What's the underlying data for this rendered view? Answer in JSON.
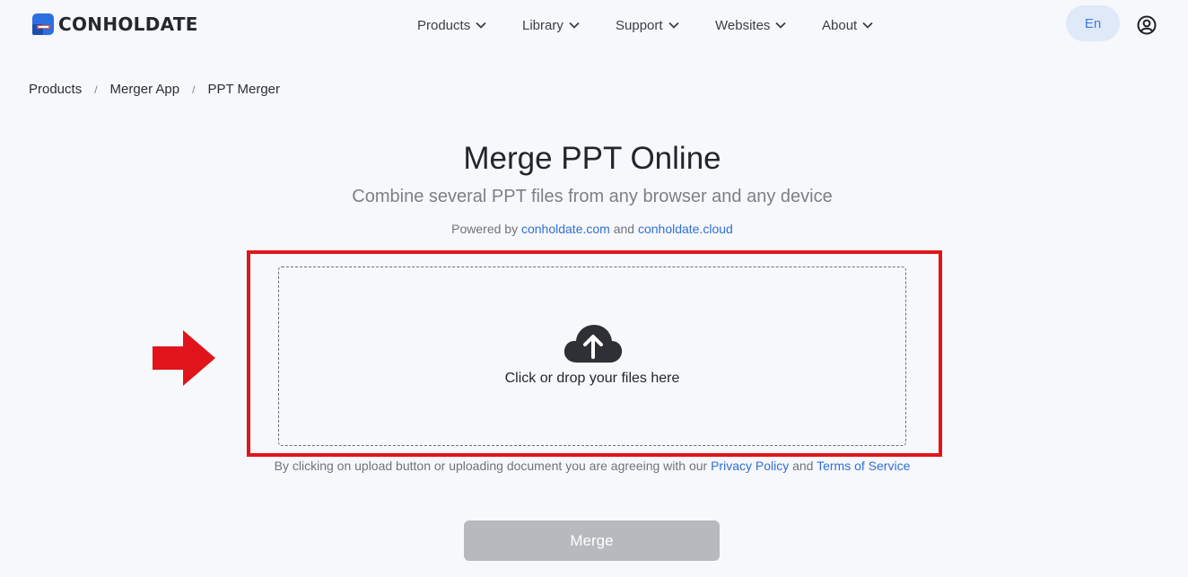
{
  "header": {
    "brand": "CONHOLDATE",
    "nav": [
      {
        "label": "Products"
      },
      {
        "label": "Library"
      },
      {
        "label": "Support"
      },
      {
        "label": "Websites"
      },
      {
        "label": "About"
      }
    ],
    "language": "En"
  },
  "breadcrumb": [
    "Products",
    "Merger App",
    "PPT Merger"
  ],
  "hero": {
    "title": "Merge PPT Online",
    "subtitle": "Combine several PPT files from any browser and any device",
    "powered_prefix": "Powered by",
    "powered_link1": "conholdate.com",
    "powered_and": "and",
    "powered_link2": "conholdate.cloud"
  },
  "dropzone": {
    "label": "Click or drop your files here"
  },
  "agreement": {
    "text": "By clicking on upload button or uploading document you are agreeing with our",
    "privacy": "Privacy Policy",
    "and": "and",
    "terms": "Terms of Service"
  },
  "merge_button": "Merge",
  "colors": {
    "accent": "#2f6fd6",
    "highlight": "#e1141c",
    "disabled_button": "#b6b9be"
  },
  "icons": {
    "logo": "conholdate-logo-icon",
    "chevron": "chevron-down-icon",
    "user": "user-account-icon",
    "upload": "cloud-upload-icon",
    "arrow": "right-arrow-icon"
  }
}
